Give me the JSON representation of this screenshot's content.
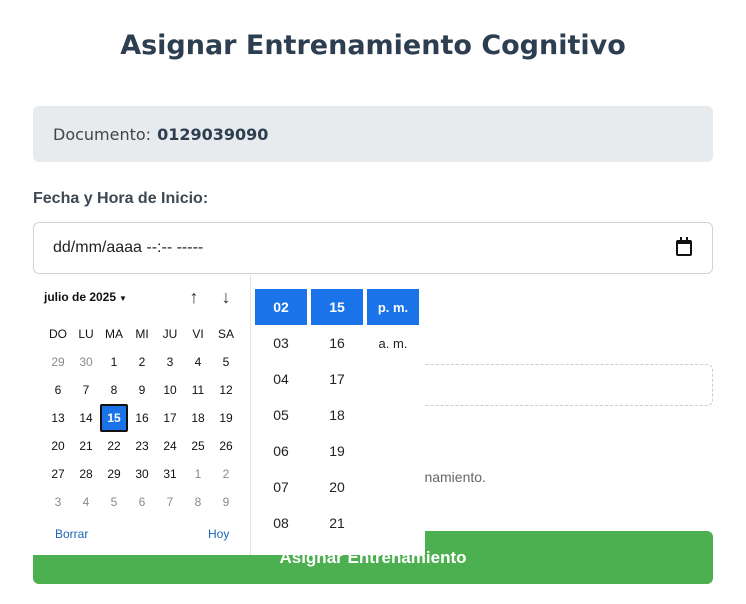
{
  "page": {
    "title": "Asignar Entrenamiento Cognitivo"
  },
  "document": {
    "label": "Documento:",
    "value": "0129039090"
  },
  "datetime": {
    "label": "Fecha y Hora de Inicio:",
    "placeholder": "dd/mm/aaaa --:-- -----"
  },
  "background": {
    "partial_text": "renamiento.",
    "submit_label": "Asignar Entrenamiento"
  },
  "picker": {
    "month_label": "julio de 2025",
    "weekdays": [
      "DO",
      "LU",
      "MA",
      "MI",
      "JU",
      "VI",
      "SA"
    ],
    "weeks": [
      [
        "29",
        "30",
        "1",
        "2",
        "3",
        "4",
        "5"
      ],
      [
        "6",
        "7",
        "8",
        "9",
        "10",
        "11",
        "12"
      ],
      [
        "13",
        "14",
        "15",
        "16",
        "17",
        "18",
        "19"
      ],
      [
        "20",
        "21",
        "22",
        "23",
        "24",
        "25",
        "26"
      ],
      [
        "27",
        "28",
        "29",
        "30",
        "31",
        "1",
        "2"
      ],
      [
        "3",
        "4",
        "5",
        "6",
        "7",
        "8",
        "9"
      ]
    ],
    "selected_day": "15",
    "clear_label": "Borrar",
    "today_label": "Hoy",
    "hours": [
      "02",
      "03",
      "04",
      "05",
      "06",
      "07",
      "08"
    ],
    "minutes": [
      "15",
      "16",
      "17",
      "18",
      "19",
      "20",
      "21"
    ],
    "ampm": [
      "p. m.",
      "a. m."
    ],
    "selected_hour": "02",
    "selected_minute": "15",
    "selected_ampm": "p. m."
  }
}
